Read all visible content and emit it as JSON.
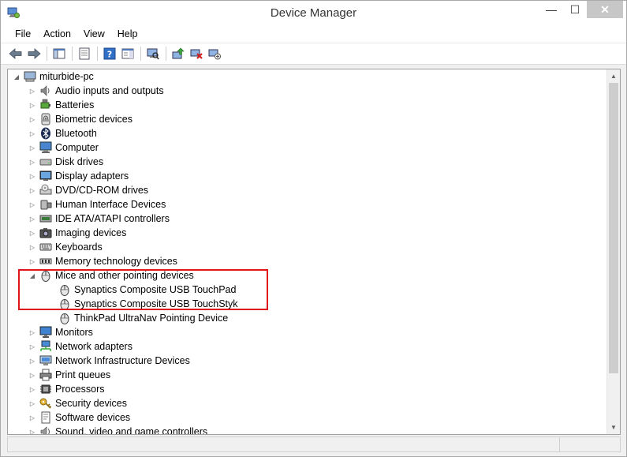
{
  "window": {
    "title": "Device Manager",
    "minimize": "—",
    "maximize": "☐",
    "close": "✕"
  },
  "menu": [
    "File",
    "Action",
    "View",
    "Help"
  ],
  "toolbar": {
    "buttons": [
      "back-icon",
      "forward-icon",
      "sep",
      "show-hide-console-tree-icon",
      "sep",
      "properties-icon",
      "sep",
      "help-icon",
      "show-action-pane-icon",
      "sep",
      "scan-hardware-icon",
      "sep",
      "update-driver-icon",
      "uninstall-icon",
      "enable-device-icon"
    ]
  },
  "tree": {
    "root": "miturbide-pc",
    "items": [
      {
        "label": "Audio inputs and outputs",
        "icon": "speaker-icon",
        "expanded": false
      },
      {
        "label": "Batteries",
        "icon": "battery-icon",
        "expanded": false
      },
      {
        "label": "Biometric devices",
        "icon": "fingerprint-icon",
        "expanded": false
      },
      {
        "label": "Bluetooth",
        "icon": "bluetooth-icon",
        "expanded": false
      },
      {
        "label": "Computer",
        "icon": "computer-icon",
        "expanded": false
      },
      {
        "label": "Disk drives",
        "icon": "disk-icon",
        "expanded": false
      },
      {
        "label": "Display adapters",
        "icon": "display-icon",
        "expanded": false
      },
      {
        "label": "DVD/CD-ROM drives",
        "icon": "dvd-icon",
        "expanded": false
      },
      {
        "label": "Human Interface Devices",
        "icon": "hid-icon",
        "expanded": false
      },
      {
        "label": "IDE ATA/ATAPI controllers",
        "icon": "ide-icon",
        "expanded": false
      },
      {
        "label": "Imaging devices",
        "icon": "camera-icon",
        "expanded": false
      },
      {
        "label": "Keyboards",
        "icon": "keyboard-icon",
        "expanded": false
      },
      {
        "label": "Memory technology devices",
        "icon": "memory-icon",
        "expanded": false
      },
      {
        "label": "Mice and other pointing devices",
        "icon": "mouse-icon",
        "expanded": true,
        "children": [
          "Synaptics Composite USB TouchPad",
          "Synaptics Composite USB TouchStyk",
          "ThinkPad UltraNav Pointing Device"
        ]
      },
      {
        "label": "Monitors",
        "icon": "monitor-icon",
        "expanded": false
      },
      {
        "label": "Network adapters",
        "icon": "network-icon",
        "expanded": false
      },
      {
        "label": "Network Infrastructure Devices",
        "icon": "network-infra-icon",
        "expanded": false
      },
      {
        "label": "Print queues",
        "icon": "printer-icon",
        "expanded": false
      },
      {
        "label": "Processors",
        "icon": "processor-icon",
        "expanded": false
      },
      {
        "label": "Security devices",
        "icon": "key-icon",
        "expanded": false
      },
      {
        "label": "Software devices",
        "icon": "software-icon",
        "expanded": false
      },
      {
        "label": "Sound, video and game controllers",
        "icon": "sound-icon",
        "expanded": false
      }
    ]
  },
  "colors": {
    "highlight": "#e0151b",
    "accent": "#1e6fd9"
  }
}
